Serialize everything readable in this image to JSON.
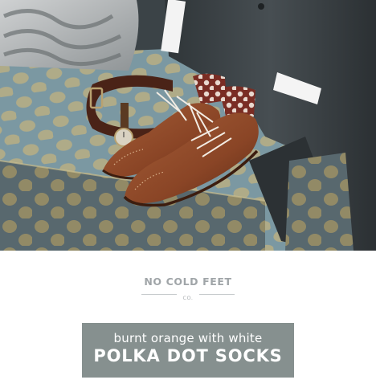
{
  "photo": {
    "subject": "brown brogue shoes with polka dot socks, watch and belt on a patterned sofa beside a suit",
    "colors": {
      "sofa": "#7f9ba4",
      "sofa_dot": "#b6ad86",
      "shoe": "#8a4a2b",
      "sock": "#6f2a22",
      "suit": "#3d4347"
    }
  },
  "logo": {
    "name": "NO COLD FEET",
    "suffix": "CO."
  },
  "banner": {
    "subtitle": "burnt orange with white",
    "title": "POLKA DOT SOCKS",
    "background": "#86908f"
  }
}
